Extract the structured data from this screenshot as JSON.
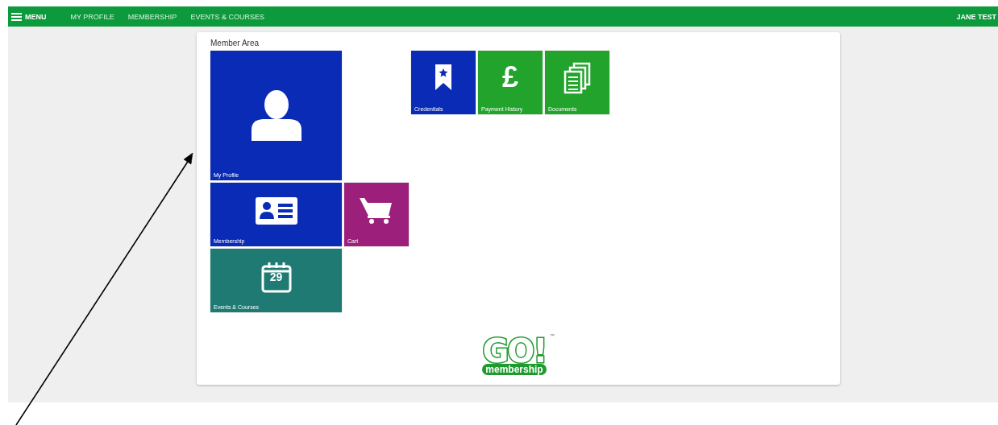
{
  "top_bar": {
    "menu": "MENU",
    "links": [
      "MY PROFILE",
      "MEMBERSHIP",
      "EVENTS & COURSES"
    ],
    "user": "JANE TEST"
  },
  "panel": {
    "title": "Member Area",
    "tiles": [
      {
        "label": "My Profile",
        "kind": "profile",
        "color": "#0a2bb5"
      },
      {
        "label": "Membership",
        "kind": "card",
        "color": "#0a2bb5"
      },
      {
        "label": "Cart",
        "kind": "cart",
        "color": "#9c1f7c"
      },
      {
        "label": "Events & Courses",
        "kind": "calendar",
        "color": "#1e7a73",
        "icon_text": "29"
      },
      {
        "label": "Credentials",
        "kind": "ribbon",
        "color": "#0a2bb5"
      },
      {
        "label": "Payment History",
        "kind": "pound",
        "color": "#22a32c",
        "icon_text": "£"
      },
      {
        "label": "Documents",
        "kind": "documents",
        "color": "#22a32c"
      }
    ],
    "logo": {
      "word": "GO!",
      "sub": "membership",
      "mark": "™"
    }
  }
}
